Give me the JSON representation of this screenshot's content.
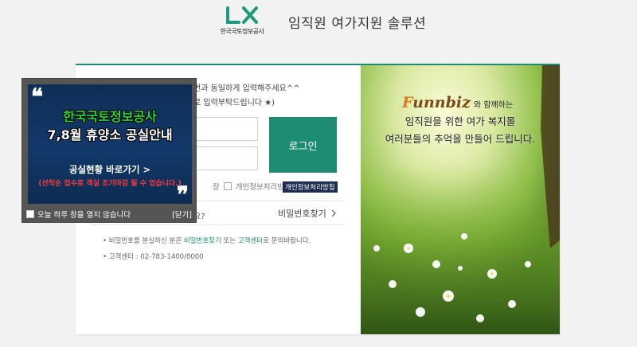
{
  "header": {
    "logo_text": "LX",
    "logo_sub": "한국국토정보공사",
    "title": "임직원 여가지원 솔루션"
  },
  "login": {
    "note_line1": "번과 동일하게 입력해주세요^^",
    "note_line2": "로 입력부탁드립니다 ★)",
    "login_button": "로그인",
    "check_label_a": "장",
    "check_label_b": "개인정보처리방침 동",
    "policy_tag": "개인정보처리방침",
    "question": "요?",
    "find_password": "비밀번호찾기",
    "help_line1_a": "비밀번호를 분실하신 분은 ",
    "help_line1_link1": "비밀번호찾기",
    "help_line1_b": " 또는 ",
    "help_line1_link2": "고객센터",
    "help_line1_c": "로 문의바랍니다.",
    "help_line2": "고객센터 : 02-783-1400/8000"
  },
  "promo": {
    "brand_first": "F",
    "brand_rest": "unnbiz",
    "brand_with": "와 함께하는",
    "line1": "임직원을 위한 여가 복지몰",
    "line2": "여러분들의 추억을 만들어 드립니다."
  },
  "popup": {
    "title1": "한국국토정보공사",
    "title2": "7,8월 휴양소 공실안내",
    "link": "공실현황 바로가기 >",
    "warning": "(선착순 접수로 객실 조기마감 될 수 있습니다.)",
    "dont_show": "오늘 하루 창을 열지 않습니다",
    "close": "[닫기]"
  },
  "colors": {
    "accent": "#1e8c74",
    "popup_bg": "#11396a",
    "popup_title_green": "#2bd13a",
    "warning_red": "#ff3b3b"
  }
}
